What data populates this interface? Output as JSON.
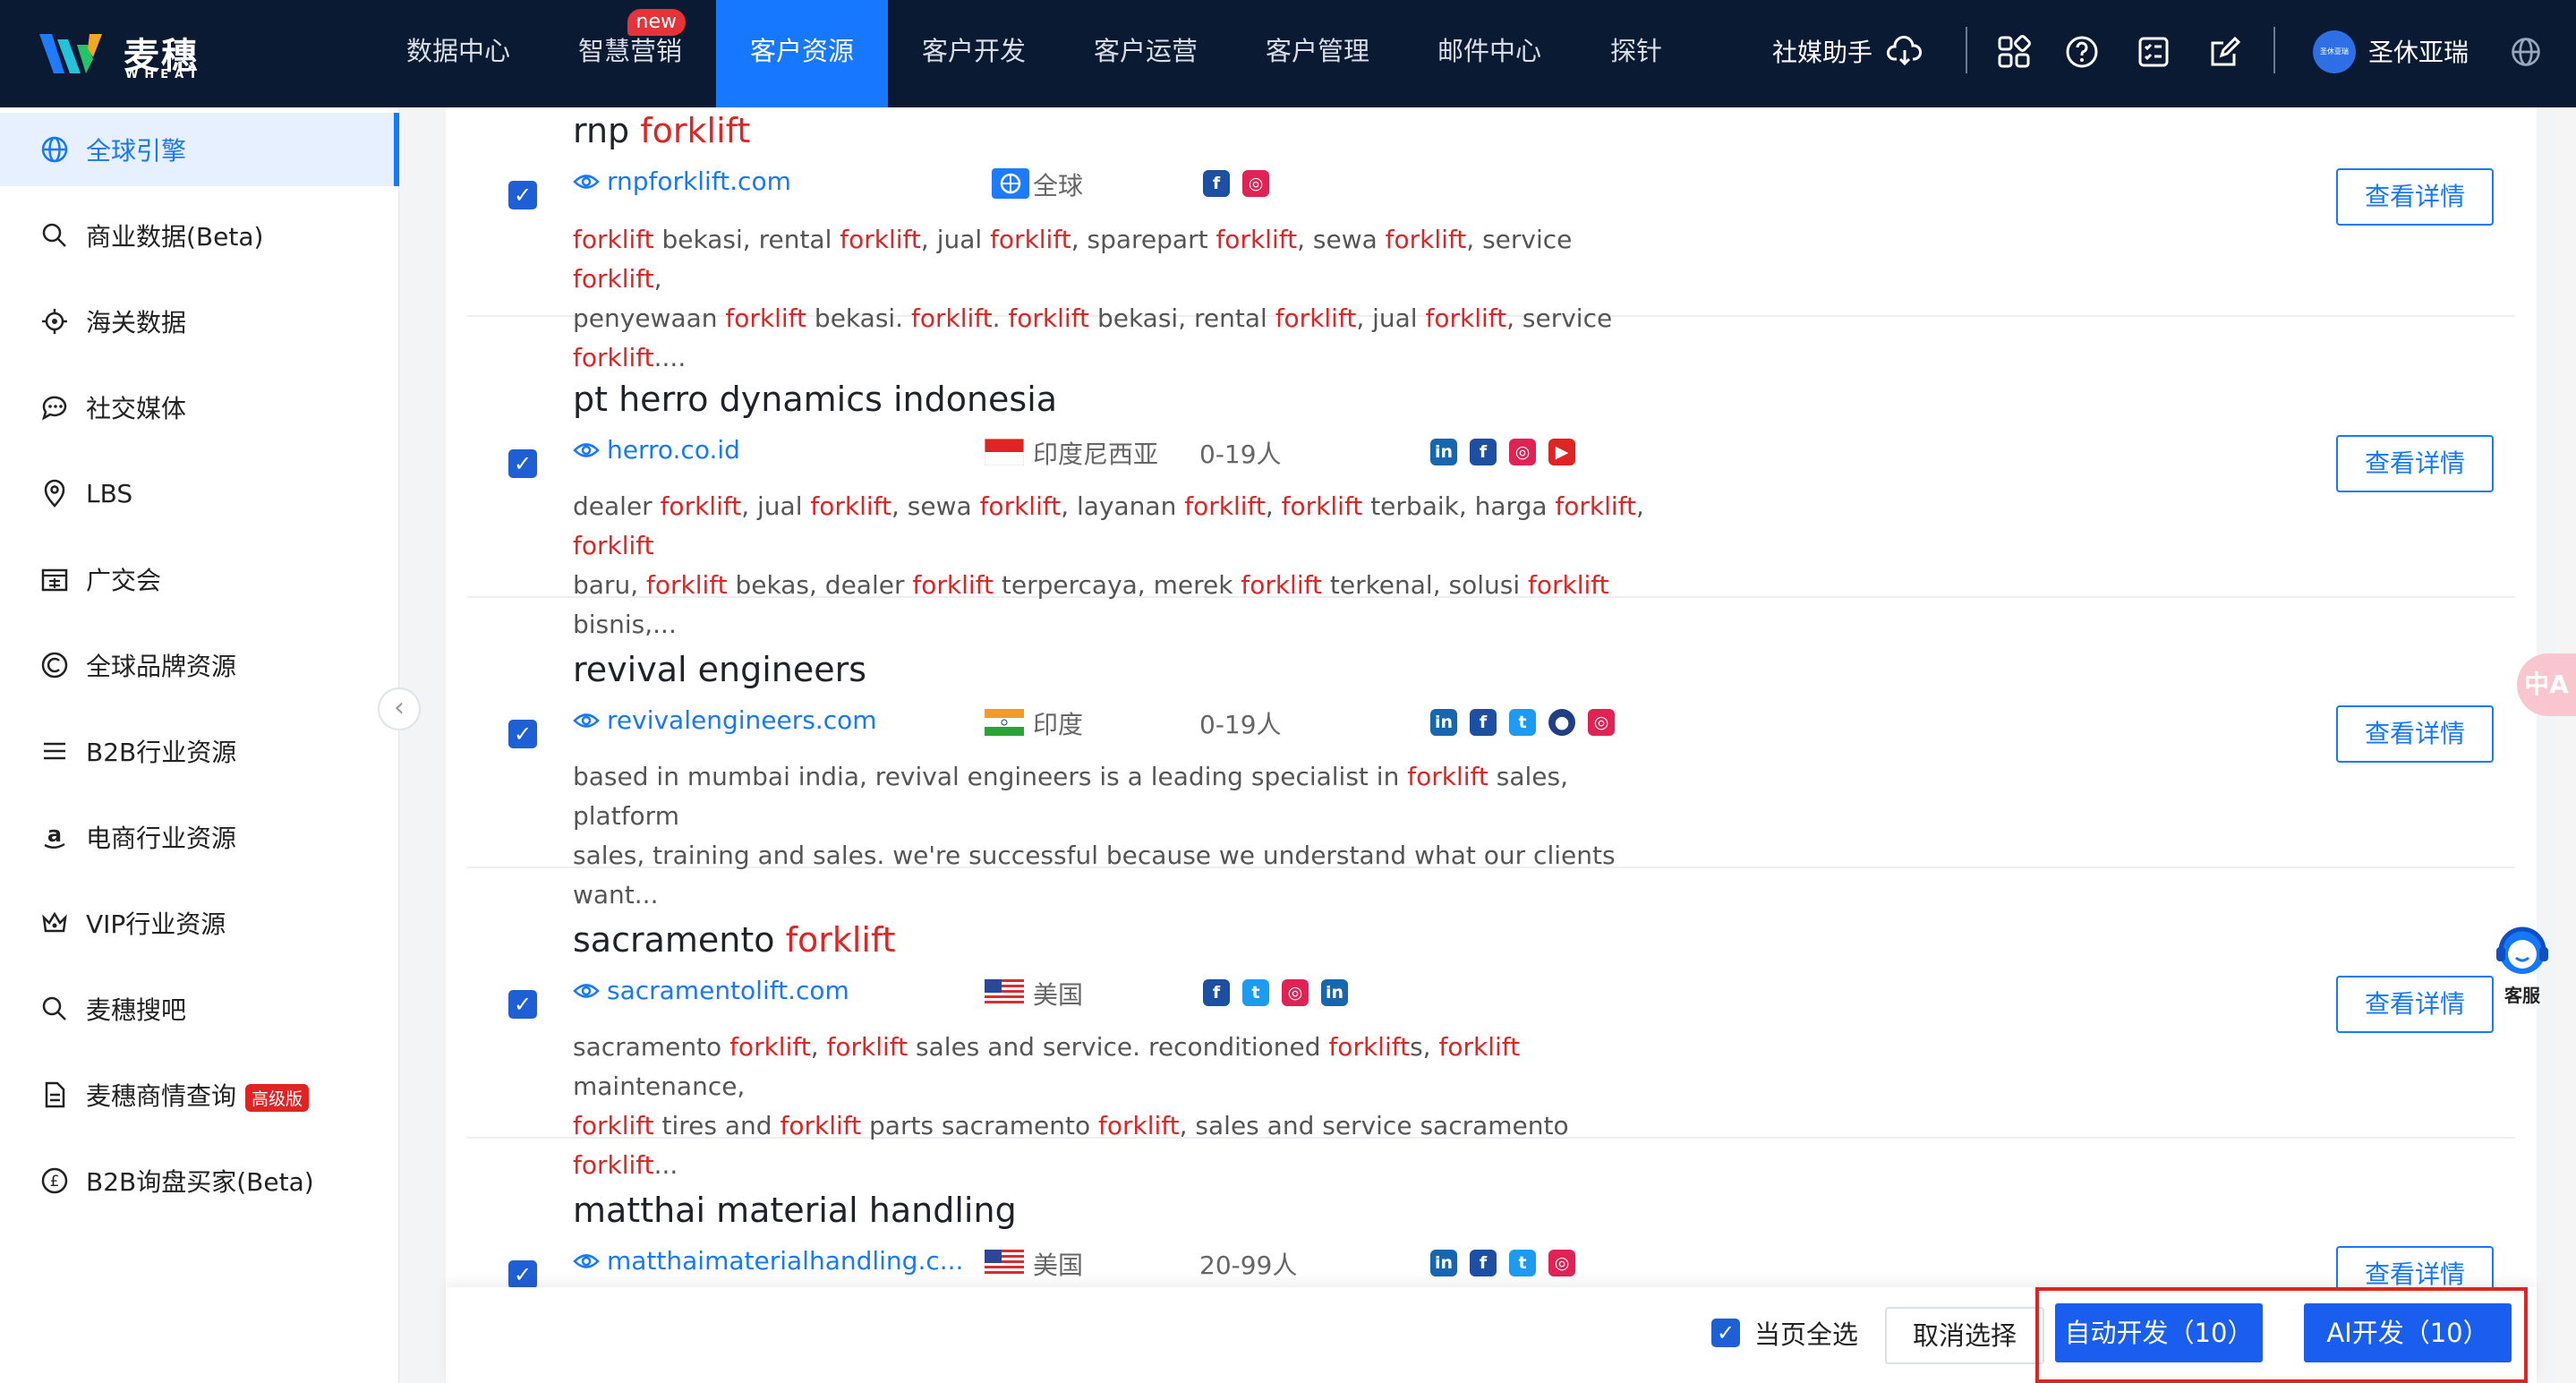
{
  "brand": {
    "name_cn": "麦穗",
    "name_en": "WHEAT"
  },
  "nav": {
    "items": [
      {
        "label": "数据中心"
      },
      {
        "label": "智慧营销",
        "badge": "new"
      },
      {
        "label": "客户资源"
      },
      {
        "label": "客户开发"
      },
      {
        "label": "客户运营"
      },
      {
        "label": "客户管理"
      },
      {
        "label": "邮件中心"
      },
      {
        "label": "探针"
      }
    ],
    "active_index": 2,
    "social_helper": "社媒助手",
    "user_name": "圣休亚瑞",
    "avatar_text": "圣休亚瑞"
  },
  "sidebar": {
    "items": [
      {
        "label": "全球引擎",
        "icon": "globe-icon",
        "active": true
      },
      {
        "label": "商业数据(Beta)",
        "icon": "search-icon"
      },
      {
        "label": "海关数据",
        "icon": "target-icon"
      },
      {
        "label": "社交媒体",
        "icon": "chat-icon"
      },
      {
        "label": "LBS",
        "icon": "location-icon"
      },
      {
        "label": "广交会",
        "icon": "fair-icon"
      },
      {
        "label": "全球品牌资源",
        "icon": "copyright-icon"
      },
      {
        "label": "B2B行业资源",
        "icon": "list-icon"
      },
      {
        "label": "电商行业资源",
        "icon": "amazon-icon"
      },
      {
        "label": "VIP行业资源",
        "icon": "crown-icon"
      },
      {
        "label": "麦穗搜吧",
        "icon": "search-icon"
      },
      {
        "label": "麦穗商情查询",
        "icon": "document-icon",
        "badge": "高级版"
      },
      {
        "label": "B2B询盘买家(Beta)",
        "icon": "pound-icon"
      }
    ]
  },
  "results": [
    {
      "title_plain": "rnp ",
      "title_hl": "forklift",
      "url": "rnpforklift.com",
      "flag": "globe",
      "country": "全球",
      "size": "",
      "socials": [
        "facebook",
        "instagram"
      ],
      "desc_lines": [
        [
          "",
          "forklift",
          " bekasi, rental ",
          "forklift",
          ", jual ",
          "forklift",
          ", sparepart ",
          "forklift",
          ", sewa ",
          "forklift",
          ", service ",
          "forklift",
          ","
        ],
        [
          "penyewaan ",
          "forklift",
          " bekasi. ",
          "forklift",
          ". ",
          "forklift",
          " bekasi, rental ",
          "forklift",
          ", jual ",
          "forklift",
          ", service ",
          "forklift",
          "...."
        ]
      ],
      "detail_label": "查看详情"
    },
    {
      "title_plain": "pt herro dynamics indonesia",
      "title_hl": "",
      "url": "herro.co.id",
      "flag": "indonesia",
      "country": "印度尼西亚",
      "size": "0-19人",
      "socials": [
        "linkedin",
        "facebook",
        "instagram",
        "youtube"
      ],
      "desc_lines": [
        [
          "dealer ",
          "forklift",
          ", jual ",
          "forklift",
          ", sewa ",
          "forklift",
          ", layanan ",
          "forklift",
          ", ",
          "forklift",
          " terbaik, harga ",
          "forklift",
          ", ",
          "forklift"
        ],
        [
          "baru, ",
          "forklift",
          " bekas, dealer ",
          "forklift",
          " terpercaya, merek ",
          "forklift",
          " terkenal, solusi ",
          "forklift",
          " bisnis,..."
        ]
      ],
      "detail_label": "查看详情"
    },
    {
      "title_plain": "revival engineers",
      "title_hl": "",
      "url": "revivalengineers.com",
      "flag": "india",
      "country": "印度",
      "size": "0-19人",
      "socials": [
        "linkedin",
        "facebook",
        "twitter",
        "location",
        "instagram"
      ],
      "desc_lines": [
        [
          "based in mumbai india, revival engineers is a leading specialist in ",
          "forklift",
          " sales, platform"
        ],
        [
          "sales, training and sales. we're successful because we understand what our clients want..."
        ]
      ],
      "detail_label": "查看详情"
    },
    {
      "title_plain": "sacramento ",
      "title_hl": "forklift",
      "url": "sacramentolift.com",
      "flag": "usa",
      "country": "美国",
      "size": "",
      "socials": [
        "facebook",
        "twitter",
        "instagram",
        "linkedin"
      ],
      "desc_lines": [
        [
          "sacramento ",
          "forklift",
          ", ",
          "forklift",
          " sales and service. reconditioned ",
          "forklift",
          "s, ",
          "forklift",
          " maintenance,"
        ],
        [
          "",
          "forklift",
          " tires and ",
          "forklift",
          " parts sacramento ",
          "forklift",
          ", sales and service sacramento ",
          "forklift",
          "..."
        ]
      ],
      "detail_label": "查看详情"
    },
    {
      "title_plain": "matthai material handling",
      "title_hl": "",
      "url": "matthaimaterialhandling.c...",
      "flag": "usa",
      "country": "美国",
      "size": "20-99人",
      "socials": [
        "linkedin",
        "facebook",
        "twitter",
        "instagram"
      ],
      "desc_lines": [],
      "detail_label": "查看详情"
    }
  ],
  "bottom": {
    "select_page": "当页全选",
    "cancel": "取消选择",
    "auto_dev": "自动开发（10）",
    "ai_dev": "AI开发（10）"
  },
  "floaters": {
    "translate": "中A",
    "service": "客服"
  },
  "colors": {
    "primary": "#1677ff",
    "nav_bg": "#0b1a33",
    "highlight": "#e02424"
  }
}
